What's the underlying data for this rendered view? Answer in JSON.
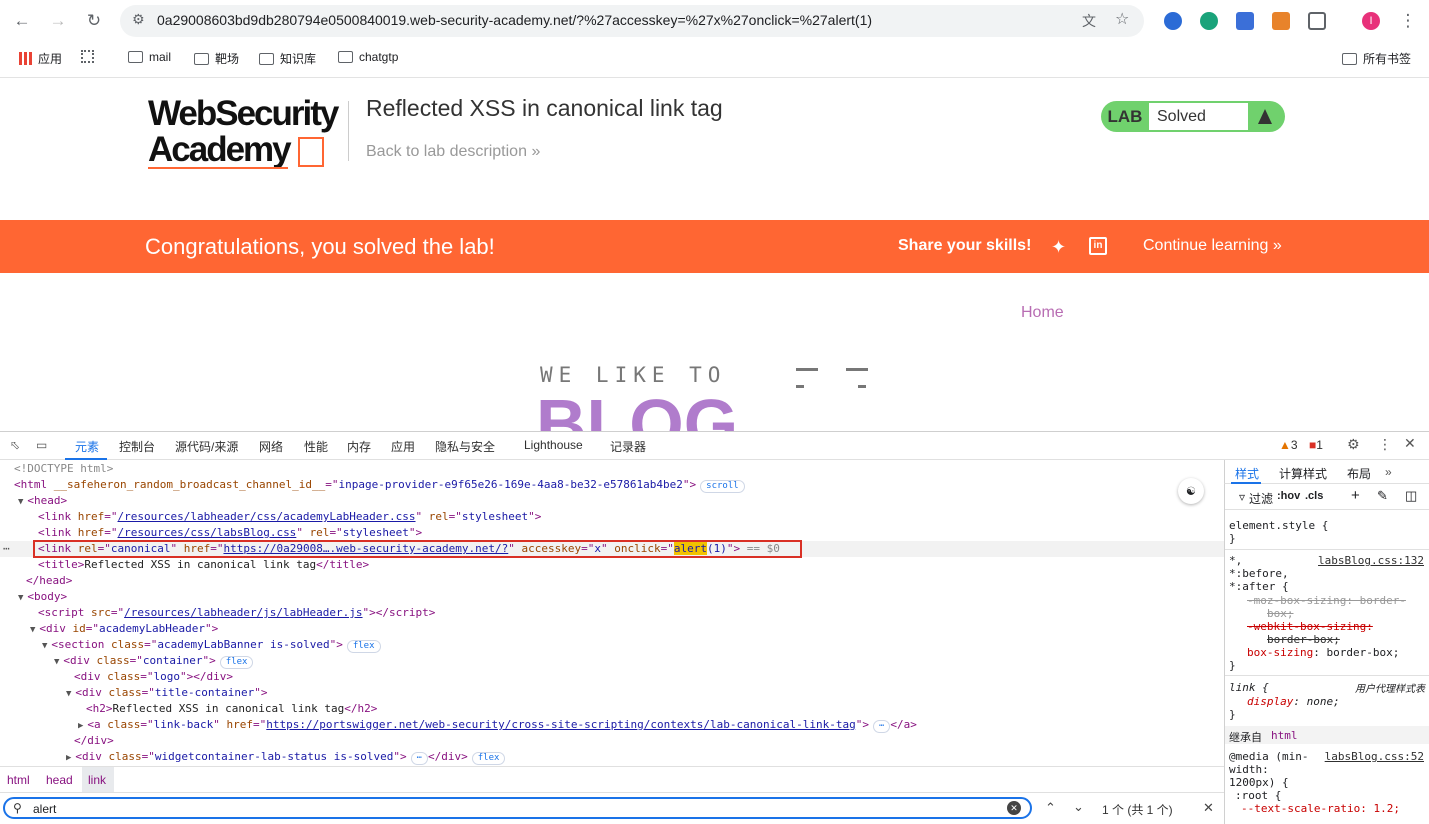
{
  "browser": {
    "url": "0a29008603bd9db280794e0500840019.web-security-academy.net/?%27accesskey=%27x%27onclick=%27alert(1)",
    "bookmarks": [
      "应用",
      "mail",
      "靶场",
      "知识库",
      "chatgtp"
    ],
    "all_bookmarks": "所有书签",
    "profile_initial": "I"
  },
  "page": {
    "logo_line1": "WebSecurity",
    "logo_line2": "Academy",
    "lab_title": "Reflected XSS in canonical link tag",
    "back_link": "Back to lab description",
    "lab_tag": "LAB",
    "lab_status": "Solved",
    "congrats": "Congratulations, you solved the lab!",
    "share": "Share your skills!",
    "continue": "Continue learning",
    "home": "Home",
    "blog_top": "WE LIKE TO",
    "blog_big": "BLOG"
  },
  "devtools": {
    "tabs": [
      "元素",
      "控制台",
      "源代码/来源",
      "网络",
      "性能",
      "内存",
      "应用",
      "隐私与安全",
      "Lighthouse",
      "记录器"
    ],
    "warnings": "3",
    "errors": "1",
    "crumbs": [
      "html",
      "head",
      "link"
    ],
    "find_value": "alert",
    "find_count": "1 个 (共 1 个)",
    "styles_tabs": [
      "样式",
      "计算样式",
      "布局"
    ],
    "filter_label": "过滤",
    "hov": ":hov",
    "cls": ".cls",
    "dom": {
      "doctype": "<!DOCTYPE html>",
      "html_attr": "__safeheron_random_broadcast_channel_id__",
      "html_attr_val": "inpage-provider-e9f65e26-169e-4aa8-be32-e57861ab4be2",
      "css1": "/resources/labheader/css/academyLabHeader.css",
      "css2": "/resources/css/labsBlog.css",
      "canonical_href": "https://0a29008….web-security-academy.net/?",
      "accesskey": "x",
      "onclick_pre": "alert",
      "onclick_post": "(1)",
      "selected_marker": "== $0",
      "title_text": "Reflected XSS in canonical link tag",
      "script_src": "/resources/labheader/js/labHeader.js",
      "div_id": "academyLabHeader",
      "section_class": "academyLabBanner is-solved",
      "container_class": "container",
      "logo_class": "logo",
      "title_container_class": "title-container",
      "h2_text": "Reflected XSS in canonical link tag",
      "a_class": "link-back",
      "a_href": "https://portswigger.net/web-security/cross-site-scripting/contexts/lab-canonical-link-tag",
      "widget_class": "widgetcontainer-lab-status is-solved",
      "badge_scroll": "scroll",
      "badge_flex": "flex"
    },
    "styles": {
      "element_style": "element.style {",
      "universal_src": "labsBlog.css:132",
      "link_rule": "link {",
      "ua_label": "用户代理样式表",
      "display_val": "none;",
      "inherited": "继承自",
      "inherited_tag": "html",
      "media": "@media (min-",
      "media2": "width:",
      "media3": "1200px) {",
      "media_src": "labsBlog.css:52",
      "root": ":root {",
      "text_scale": "--text-scale-ratio: 1.2;"
    }
  }
}
